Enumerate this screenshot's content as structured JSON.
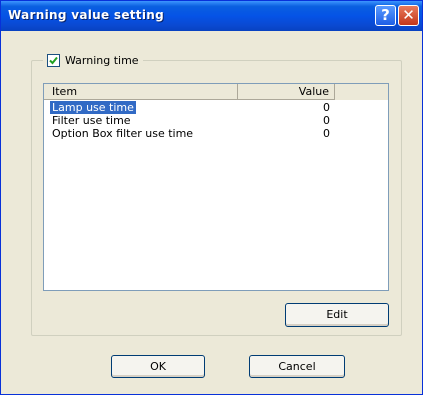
{
  "window": {
    "title": "Warning value setting",
    "help_glyph": "?",
    "close_glyph": "✕"
  },
  "group": {
    "checked": true,
    "label": "Warning time"
  },
  "list": {
    "columns": [
      "Item",
      "Value"
    ],
    "rows": [
      {
        "item": "Lamp use time",
        "value": "0",
        "selected": true
      },
      {
        "item": "Filter use time",
        "value": "0",
        "selected": false
      },
      {
        "item": "Option Box filter use time",
        "value": "0",
        "selected": false
      }
    ]
  },
  "buttons": {
    "edit": "Edit",
    "ok": "OK",
    "cancel": "Cancel"
  },
  "colors": {
    "titlebar": "#0553e6",
    "selection": "#316ac5",
    "close": "#c3361a"
  }
}
